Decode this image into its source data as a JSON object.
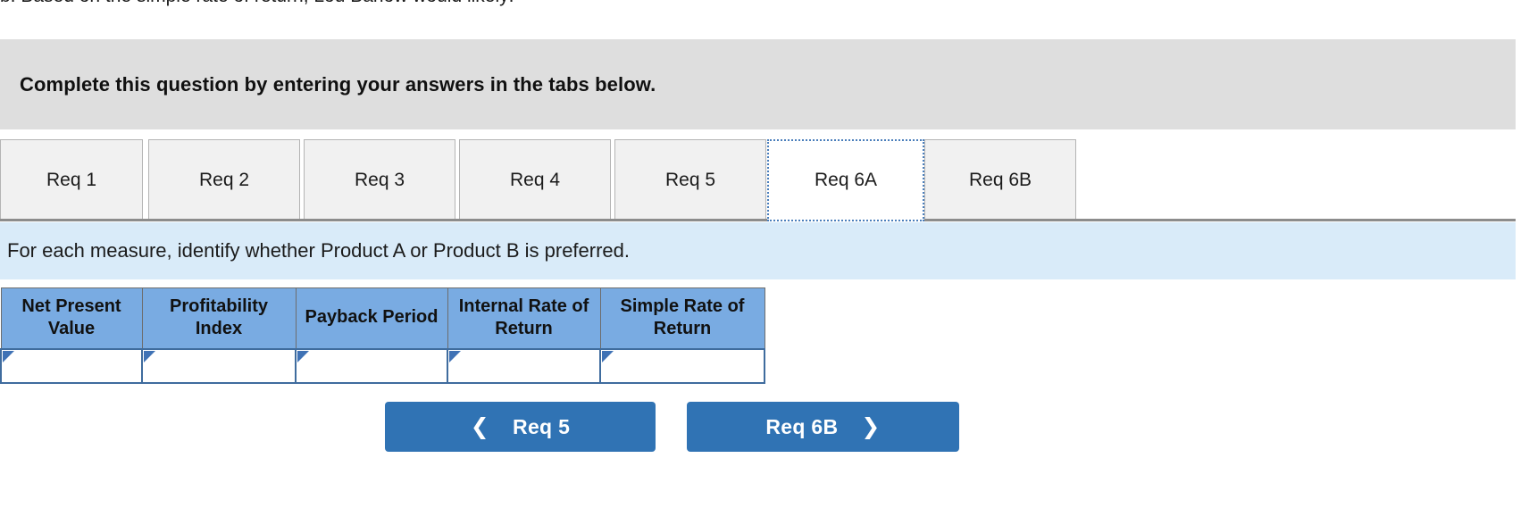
{
  "question_fragment": "b. Based on the simple rate of return, Lou Barlow would likely:",
  "banner": {
    "instruction": "Complete this question by entering your answers in the tabs below."
  },
  "tabs": [
    {
      "label": "Req 1",
      "active": false
    },
    {
      "label": "Req 2",
      "active": false
    },
    {
      "label": "Req 3",
      "active": false
    },
    {
      "label": "Req 4",
      "active": false
    },
    {
      "label": "Req 5",
      "active": false
    },
    {
      "label": "Req 6A",
      "active": true
    },
    {
      "label": "Req 6B",
      "active": false
    }
  ],
  "sub_instruction": "For each measure, identify whether Product A or Product B is preferred.",
  "table": {
    "headers": [
      "Net Present Value",
      "Profitability Index",
      "Payback Period",
      "Internal Rate of Return",
      "Simple Rate of Return"
    ],
    "row_values": [
      "",
      "",
      "",
      "",
      ""
    ],
    "header_bg": "#79abe2",
    "border_color": "#3f6c9e",
    "marker_color": "#3f72b5"
  },
  "nav": {
    "prev_label": "Req 5",
    "prev_icon": "chevron-left-icon",
    "next_label": "Req 6B",
    "next_icon": "chevron-right-icon",
    "button_color": "#3073b4"
  }
}
